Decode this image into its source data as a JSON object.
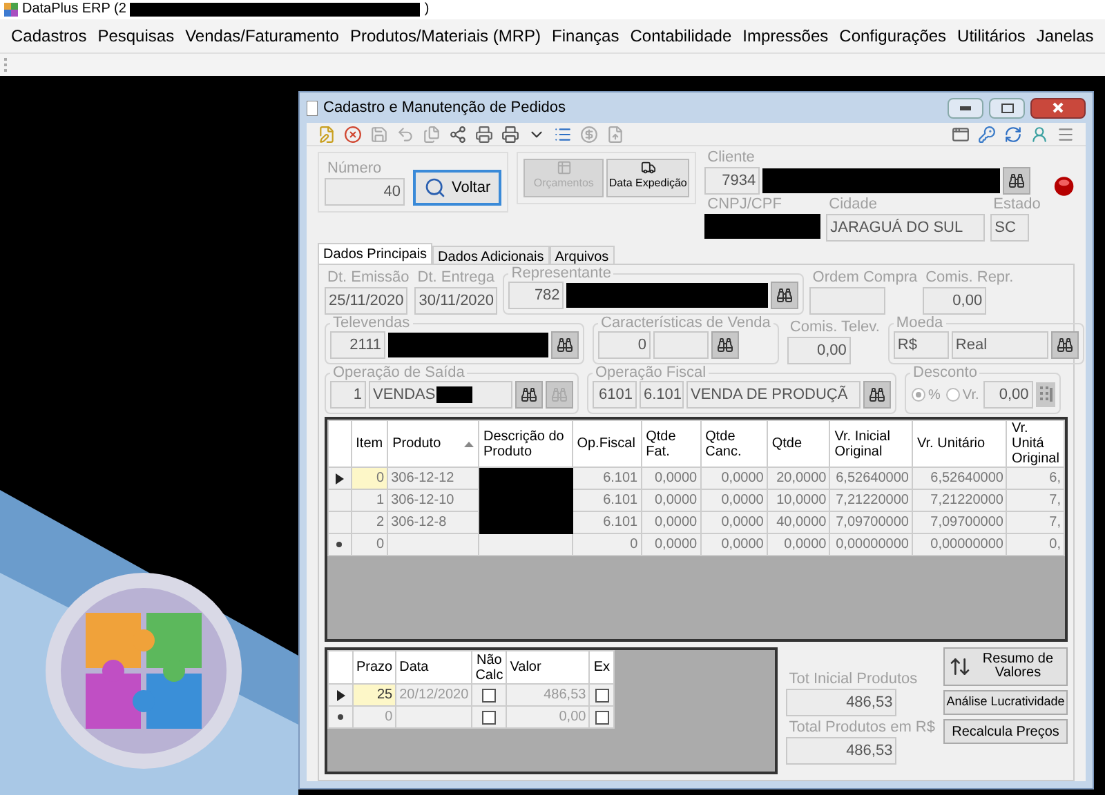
{
  "app_title": {
    "text": "DataPlus ERP (2",
    "suffix": ")"
  },
  "menu": [
    "Cadastros",
    "Pesquisas",
    "Vendas/Faturamento",
    "Produtos/Materiais (MRP)",
    "Finanças",
    "Contabilidade",
    "Impressões",
    "Configurações",
    "Utilitários",
    "Janelas"
  ],
  "window": {
    "title": "Cadastro e Manutenção de Pedidos"
  },
  "header": {
    "numero_label": "Número",
    "numero": "40",
    "voltar": "Voltar",
    "orcamentos": {
      "label": "Orçamentos",
      "disabled": true
    },
    "data_expedicao": "Data Expedição",
    "cliente_label": "Cliente",
    "cliente_code": "7934",
    "cnpj_label": "CNPJ/CPF",
    "cidade_label": "Cidade",
    "cidade": "JARAGUÁ DO SUL",
    "estado_label": "Estado",
    "estado": "SC"
  },
  "tabs": [
    {
      "label": "Dados Principais",
      "selected": true
    },
    {
      "label": "Dados Adicionais",
      "selected": false
    },
    {
      "label": "Arquivos",
      "selected": false
    }
  ],
  "form": {
    "dt_emissao": {
      "label": "Dt. Emissão",
      "value": "25/11/2020"
    },
    "dt_entrega": {
      "label": "Dt. Entrega",
      "value": "30/11/2020"
    },
    "representante": {
      "label": "Representante",
      "code": "782"
    },
    "ordem_compra": {
      "label": "Ordem Compra"
    },
    "comis_repr": {
      "label": "Comis. Repr.",
      "value": "0,00"
    },
    "televendas": {
      "label": "Televendas",
      "code": "2111"
    },
    "caracteristicas": {
      "label": "Características de Venda",
      "code": "0"
    },
    "comis_telev": {
      "label": "Comis. Telev.",
      "value": "0,00"
    },
    "moeda": {
      "label": "Moeda",
      "symbol": "R$",
      "name": "Real"
    },
    "operacao_saida": {
      "label": "Operação de Saída",
      "code": "1",
      "name": "VENDAS"
    },
    "operacao_fiscal": {
      "label": "Operação Fiscal",
      "code": "6101",
      "cfop": "6.101",
      "name": "VENDA DE PRODUÇÃ"
    },
    "desconto": {
      "label": "Desconto",
      "options": [
        {
          "label": "%",
          "selected": true
        },
        {
          "label": "Vr.",
          "selected": false
        }
      ],
      "value": "0,00"
    }
  },
  "items_grid": {
    "columns": [
      {
        "label": "Item",
        "sorted": false
      },
      {
        "label": "Produto",
        "sorted": true
      },
      {
        "label": "Descrição do Produto",
        "sorted": false
      },
      {
        "label": "Op.Fiscal",
        "sorted": false
      },
      {
        "label": "Qtde Fat.",
        "sorted": false
      },
      {
        "label": "Qtde Canc.",
        "sorted": false
      },
      {
        "label": "Qtde",
        "sorted": false
      },
      {
        "label": "Vr. Inicial Original",
        "sorted": false
      },
      {
        "label": "Vr. Unitário",
        "sorted": false
      },
      {
        "label": "Vr. Unitá Original",
        "sorted": false
      }
    ],
    "rows": [
      {
        "current": true,
        "new_row": false,
        "selected": true,
        "item": "0",
        "produto": "306-12-12",
        "description_hidden": true,
        "op_fiscal": "6.101",
        "qtde_fat": "0,0000",
        "qtde_canc": "0,0000",
        "qtde": "20,0000",
        "vr_inicial": "6,52640000",
        "vr_unitario": "6,52640000",
        "column_10": "6,"
      },
      {
        "current": false,
        "new_row": false,
        "selected": false,
        "item": "1",
        "produto": "306-12-10",
        "description_hidden": true,
        "op_fiscal": "6.101",
        "qtde_fat": "0,0000",
        "qtde_canc": "0,0000",
        "qtde": "10,0000",
        "vr_inicial": "7,21220000",
        "vr_unitario": "7,21220000",
        "column_10": "7,"
      },
      {
        "current": false,
        "new_row": false,
        "selected": false,
        "item": "2",
        "produto": "306-12-8",
        "description_hidden": true,
        "op_fiscal": "6.101",
        "qtde_fat": "0,0000",
        "qtde_canc": "0,0000",
        "qtde": "40,0000",
        "vr_inicial": "7,09700000",
        "vr_unitario": "7,09700000",
        "column_10": "7,"
      },
      {
        "current": false,
        "new_row": true,
        "selected": false,
        "item": "0",
        "description_hidden": false,
        "op_fiscal": "0",
        "qtde_fat": "0,0000",
        "qtde_canc": "0,0000",
        "qtde": "0,0000",
        "vr_inicial": "0,00000000",
        "vr_unitario": "0,00000000",
        "column_10": "0,"
      }
    ]
  },
  "payments_grid": {
    "columns": [
      "Prazo",
      "Data",
      "Não Calc",
      "Valor",
      "Ex"
    ],
    "rows": [
      {
        "current": true,
        "new_row": false,
        "selected": true,
        "prazo": "25",
        "data": "20/12/2020",
        "nao_calc": false,
        "valor": "486,53",
        "ex": false
      },
      {
        "current": false,
        "new_row": true,
        "selected": false,
        "prazo": "0",
        "nao_calc": false,
        "valor": "0,00",
        "ex": false
      }
    ]
  },
  "totals": {
    "tot_inicial_label": "Tot Inicial Produtos",
    "tot_inicial": "486,53",
    "total_label": "Total Produtos em R$",
    "total": "486,53"
  },
  "buttons": {
    "resumo": "Resumo de Valores",
    "analise": "Análise Lucratividade",
    "recalcula": "Recalcula Preços"
  }
}
